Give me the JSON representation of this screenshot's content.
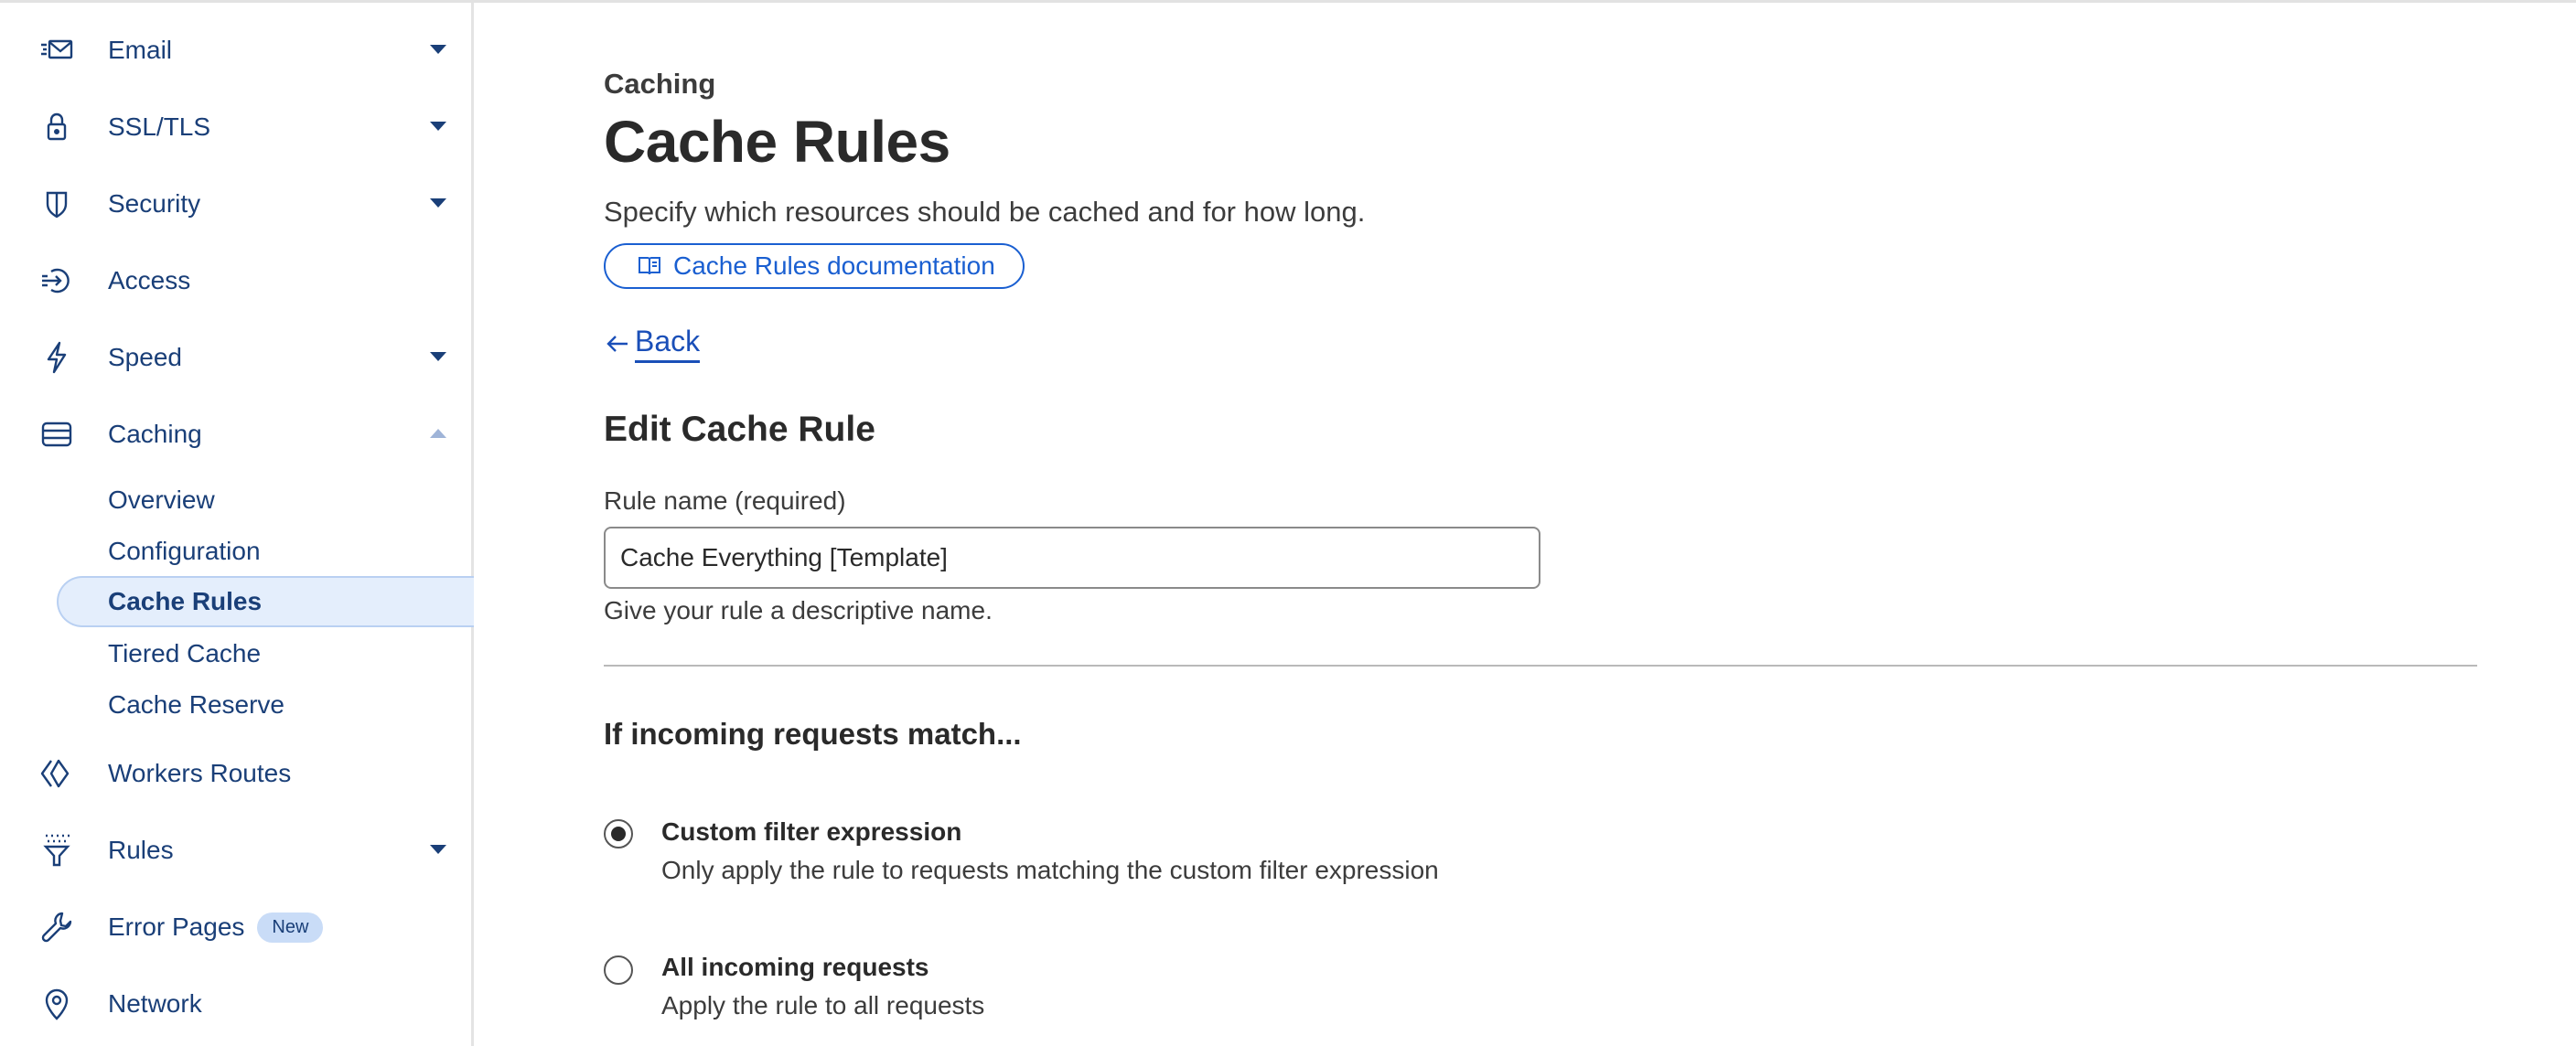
{
  "sidebar": {
    "items": [
      {
        "label": "Email",
        "icon": "email-icon",
        "expandable": true
      },
      {
        "label": "SSL/TLS",
        "icon": "lock-icon",
        "expandable": true
      },
      {
        "label": "Security",
        "icon": "shield-icon",
        "expandable": true
      },
      {
        "label": "Access",
        "icon": "access-icon",
        "expandable": false
      },
      {
        "label": "Speed",
        "icon": "lightning-icon",
        "expandable": true
      },
      {
        "label": "Caching",
        "icon": "caching-icon",
        "expanded": true
      },
      {
        "label": "Workers Routes",
        "icon": "workers-icon",
        "expandable": false
      },
      {
        "label": "Rules",
        "icon": "rules-icon",
        "expandable": true
      },
      {
        "label": "Error Pages",
        "icon": "wrench-icon",
        "badge": "New"
      },
      {
        "label": "Network",
        "icon": "location-pin-icon",
        "expandable": false
      }
    ],
    "caching_sub": [
      "Overview",
      "Configuration",
      "Cache Rules",
      "Tiered Cache",
      "Cache Reserve"
    ],
    "active_sub": "Cache Rules"
  },
  "main": {
    "breadcrumb": "Caching",
    "title": "Cache Rules",
    "description": "Specify which resources should be cached and for how long.",
    "doc_link": "Cache Rules documentation",
    "back_label": "Back",
    "section_title": "Edit Cache Rule",
    "rule_name_label": "Rule name (required)",
    "rule_name_value": "Cache Everything [Template]",
    "rule_name_helper": "Give your rule a descriptive name.",
    "match_title": "If incoming requests match...",
    "options": [
      {
        "title": "Custom filter expression",
        "desc": "Only apply the rule to requests matching the custom filter expression",
        "selected": true
      },
      {
        "title": "All incoming requests",
        "desc": "Apply the rule to all requests",
        "selected": false
      }
    ]
  },
  "colors": {
    "nav_text": "#1a3f78",
    "link": "#1a5fd1",
    "active_bg": "#e4eefc",
    "badge_bg": "#c9dcf7"
  }
}
